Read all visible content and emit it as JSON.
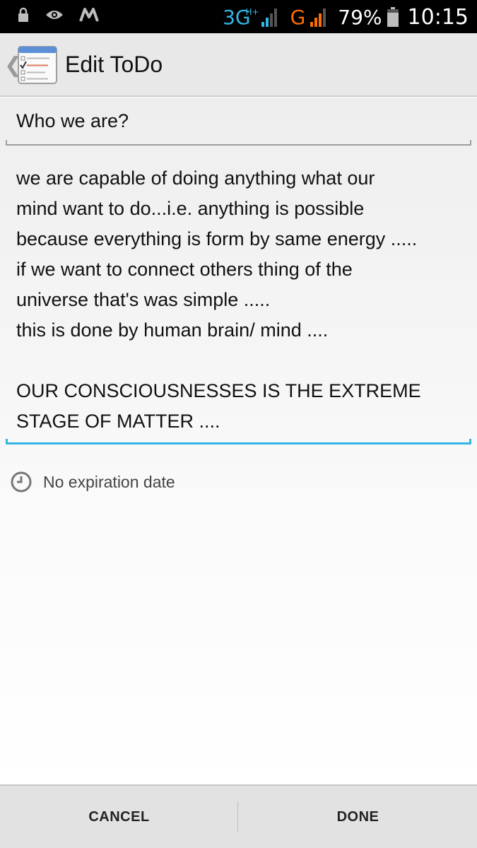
{
  "status_bar": {
    "network_3g": "3G",
    "network_3g_sup": "H+",
    "network_g": "G",
    "battery_percent": "79%",
    "time": "10:15",
    "icons": [
      "lock-icon",
      "eye-icon",
      "m-app-icon",
      "signal-icon",
      "battery-icon"
    ],
    "colors": {
      "network_3g": "#33b5e5",
      "network_g": "#ff6d00"
    }
  },
  "action_bar": {
    "title": "Edit ToDo",
    "icons": [
      "back-chevron-icon",
      "todo-list-icon"
    ]
  },
  "form": {
    "title_value": "Who we are?",
    "body_value": "we are capable of doing anything what our\nmind want to do...i.e. anything is possible\nbecause everything is form by same energy .....\nif we want to connect others thing of the\nuniverse that's was simple .....\nthis is done by human brain/ mind ....\n\nOUR CONSCIOUSNESSES IS THE EXTREME\nSTAGE OF MATTER ....",
    "expiration_text": "No expiration date",
    "accent_color": "#33b5e5"
  },
  "bottom_bar": {
    "cancel_label": "CANCEL",
    "done_label": "DONE"
  }
}
